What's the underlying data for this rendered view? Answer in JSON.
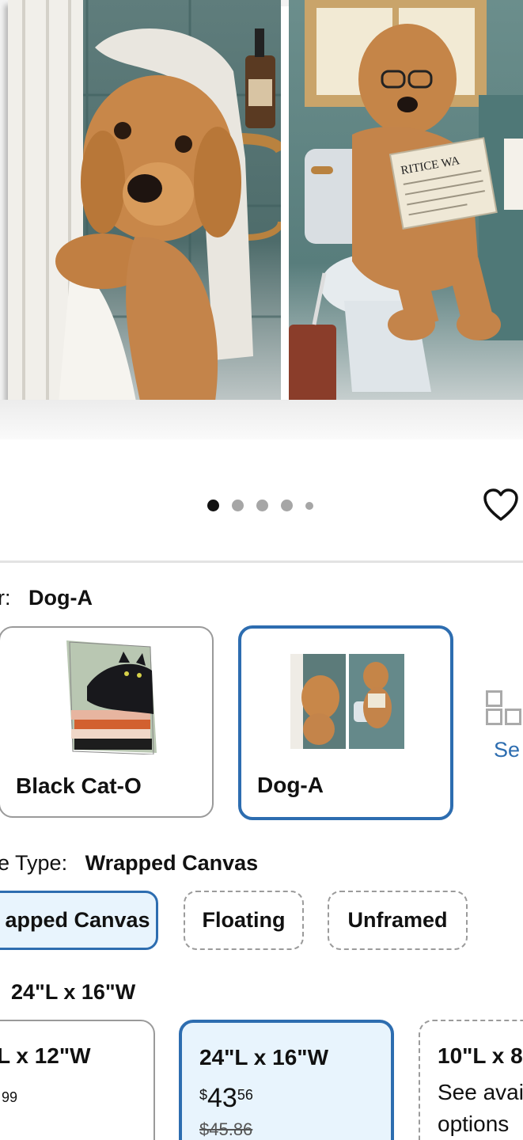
{
  "hero": {
    "newspaper_text": "RITICE WA"
  },
  "carousel": {
    "slide_count": 5,
    "active_index": 0
  },
  "style": {
    "label": "r:",
    "selected_value": "Dog-A",
    "options": [
      {
        "name": "Black Cat-O"
      },
      {
        "name": "Dog-A"
      }
    ],
    "see_more": "Se"
  },
  "frame_type": {
    "label": "e Type:",
    "selected_value": "Wrapped Canvas",
    "options": [
      {
        "label": "apped Canvas"
      },
      {
        "label": "Floating"
      },
      {
        "label": "Unframed"
      }
    ]
  },
  "size": {
    "selected_value": "24\"L x 16\"W",
    "options": [
      {
        "title": "L x 12\"W",
        "price_cents": "99"
      },
      {
        "title": "24\"L x 16\"W",
        "currency": "$",
        "price_dollars": "43",
        "price_cents": "56",
        "was_price": "$45.86"
      },
      {
        "title": "10\"L x 8\"",
        "availability_line1": "See avai",
        "availability_line2": "options"
      }
    ]
  },
  "colors": {
    "accent": "#2d6db0",
    "selected_fill": "#e8f4fd",
    "border_gray": "#9a9a9a"
  }
}
